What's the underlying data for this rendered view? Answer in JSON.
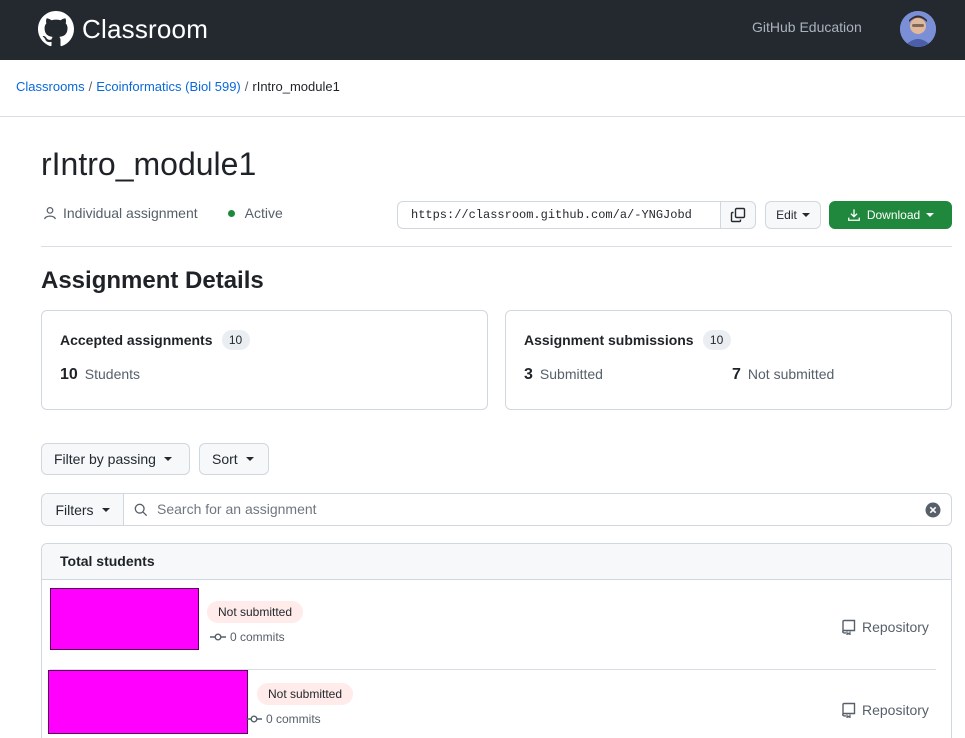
{
  "header": {
    "app_name": "Classroom",
    "education_link": "GitHub Education"
  },
  "breadcrumb": {
    "items": [
      "Classrooms",
      "Ecoinformatics (Biol 599)"
    ],
    "separator": "/",
    "current": "rIntro_module1"
  },
  "assignment": {
    "title": "rIntro_module1",
    "type": "Individual assignment",
    "status": "Active",
    "invite_url": "https://classroom.github.com/a/-YNGJobd",
    "edit_label": "Edit",
    "download_label": "Download"
  },
  "details": {
    "title": "Assignment Details",
    "accepted": {
      "label": "Accepted assignments",
      "count": "10",
      "students_num": "10",
      "students_label": "Students"
    },
    "submissions": {
      "label": "Assignment submissions",
      "count": "10",
      "submitted_num": "3",
      "submitted_label": "Submitted",
      "not_submitted_num": "7",
      "not_submitted_label": "Not submitted"
    }
  },
  "controls": {
    "filter_passing": "Filter by passing",
    "sort": "Sort",
    "filters": "Filters",
    "search_placeholder": "Search for an assignment"
  },
  "students": {
    "header": "Total students",
    "rows": [
      {
        "status": "Not submitted",
        "commits": "0 commits",
        "repo_label": "Repository"
      },
      {
        "status": "Not submitted",
        "commits": "0 commits",
        "repo_label": "Repository"
      }
    ]
  },
  "colors": {
    "header_bg": "#24292f",
    "link": "#0969da",
    "primary_green": "#1f883d",
    "redaction": "#ff00ff",
    "not_submitted_badge": "#ffebe9"
  },
  "icons": [
    "github-mark-icon",
    "person-icon",
    "copy-icon",
    "download-icon",
    "search-icon",
    "clear-icon",
    "commit-icon",
    "repo-icon",
    "caret-down-icon"
  ]
}
